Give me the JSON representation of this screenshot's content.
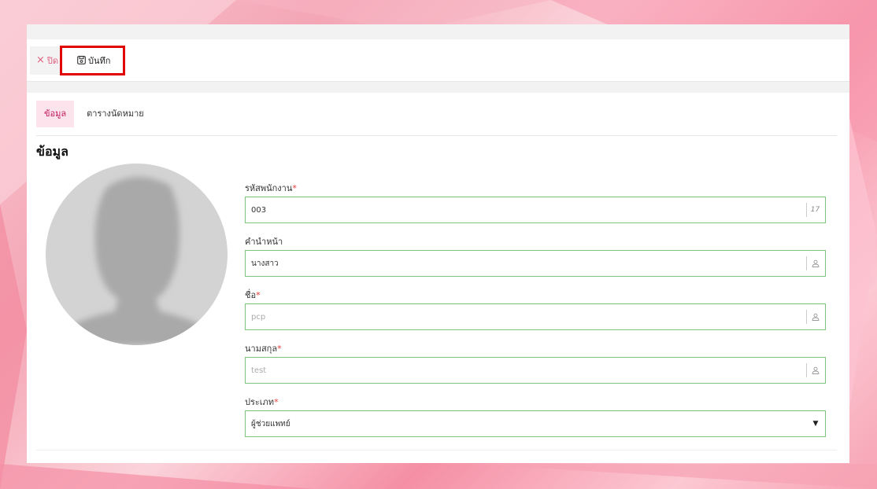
{
  "toolbar": {
    "close_label": "ปิด",
    "save_label": "บันทึก"
  },
  "tabs": [
    {
      "label": "ข้อมูล",
      "active": true
    },
    {
      "label": "ตารางนัดหมาย",
      "active": false
    }
  ],
  "section_title": "ข้อมูล",
  "form": {
    "employee_code": {
      "label": "รหัสพนักงาน",
      "required": "*",
      "value": "003",
      "suffix": "17"
    },
    "prefix": {
      "label": "คำนำหน้า",
      "required": "",
      "value": "นางสาว"
    },
    "first_name": {
      "label": "ชื่อ",
      "required": "*",
      "value": "pcp"
    },
    "last_name": {
      "label": "นามสกุล",
      "required": "*",
      "value": "test"
    },
    "type": {
      "label": "ประเภท",
      "required": "*",
      "value": "ผู้ช่วยแพทย์"
    }
  },
  "colors": {
    "accent": "#c2185b",
    "highlight_border": "#e00000",
    "field_border": "#7ec27e",
    "required": "#e53935"
  },
  "icons": [
    "close-icon",
    "save-icon",
    "user-icon",
    "number-icon",
    "caret-down-icon"
  ]
}
